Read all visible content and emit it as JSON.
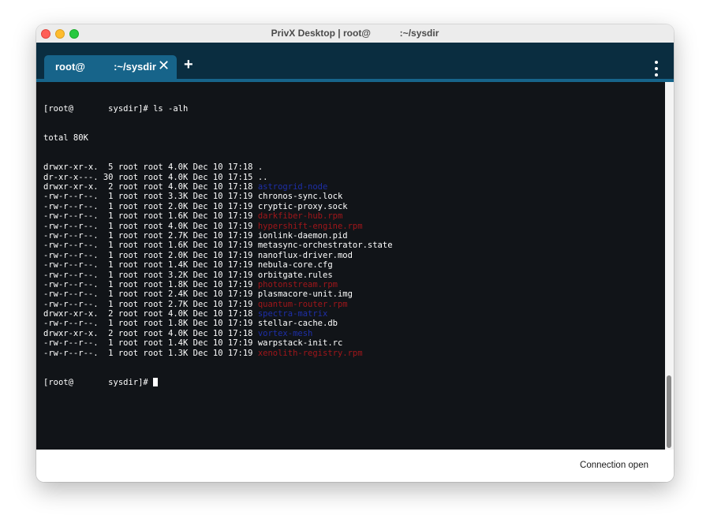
{
  "window": {
    "title": "PrivX Desktop | root@           :~/sysdir"
  },
  "tabs": [
    {
      "label": "root@          :~/sysdir",
      "close_icon": "close-icon"
    }
  ],
  "tabbar": {
    "new_tab_label": "+",
    "menu_icon": "vertical-dots-icon"
  },
  "terminal": {
    "prompt_command": "[root@       sysdir]# ls -alh",
    "total": "total 80K",
    "entries": [
      {
        "meta": "drwxr-xr-x.  5 root root 4.0K Dec 10 17:18 ",
        "name": "."
      },
      {
        "meta": "dr-xr-x---. 30 root root 4.0K Dec 10 17:15 ",
        "name": ".."
      },
      {
        "meta": "drwxr-xr-x.  2 root root 4.0K Dec 10 17:18 ",
        "name": "astrogrid-node"
      },
      {
        "meta": "-rw-r--r--.  1 root root 3.3K Dec 10 17:19 ",
        "name": "chronos-sync.lock"
      },
      {
        "meta": "-rw-r--r--.  1 root root 2.0K Dec 10 17:19 ",
        "name": "cryptic-proxy.sock"
      },
      {
        "meta": "-rw-r--r--.  1 root root 1.6K Dec 10 17:19 ",
        "name": "darkfiber-hub.rpm"
      },
      {
        "meta": "-rw-r--r--.  1 root root 4.0K Dec 10 17:19 ",
        "name": "hypershift-engine.rpm"
      },
      {
        "meta": "-rw-r--r--.  1 root root 2.7K Dec 10 17:19 ",
        "name": "ionlink-daemon.pid"
      },
      {
        "meta": "-rw-r--r--.  1 root root 1.6K Dec 10 17:19 ",
        "name": "metasync-orchestrator.state"
      },
      {
        "meta": "-rw-r--r--.  1 root root 2.0K Dec 10 17:19 ",
        "name": "nanoflux-driver.mod"
      },
      {
        "meta": "-rw-r--r--.  1 root root 1.4K Dec 10 17:19 ",
        "name": "nebula-core.cfg"
      },
      {
        "meta": "-rw-r--r--.  1 root root 3.2K Dec 10 17:19 ",
        "name": "orbitgate.rules"
      },
      {
        "meta": "-rw-r--r--.  1 root root 1.8K Dec 10 17:19 ",
        "name": "photonstream.rpm"
      },
      {
        "meta": "-rw-r--r--.  1 root root 2.4K Dec 10 17:19 ",
        "name": "plasmacore-unit.img"
      },
      {
        "meta": "-rw-r--r--.  1 root root 2.7K Dec 10 17:19 ",
        "name": "quantum-router.rpm"
      },
      {
        "meta": "drwxr-xr-x.  2 root root 4.0K Dec 10 17:18 ",
        "name": "spectra-matrix"
      },
      {
        "meta": "-rw-r--r--.  1 root root 1.8K Dec 10 17:19 ",
        "name": "stellar-cache.db"
      },
      {
        "meta": "drwxr-xr-x.  2 root root 4.0K Dec 10 17:18 ",
        "name": "vortex-mesh"
      },
      {
        "meta": "-rw-r--r--.  1 root root 1.4K Dec 10 17:19 ",
        "name": "warpstack-init.rc"
      },
      {
        "meta": "-rw-r--r--.  1 root root 1.3K Dec 10 17:19 ",
        "name": "xenolith-registry.rpm"
      }
    ],
    "final_prompt": "[root@       sysdir]# "
  },
  "status": {
    "text": "Connection open"
  },
  "colors": {
    "tabbar_bg": "#0a2d40",
    "tab_active": "#17648a",
    "terminal_bg": "#111418",
    "dir_color": "#1e2fa8",
    "rpm_color": "#a0161a"
  }
}
